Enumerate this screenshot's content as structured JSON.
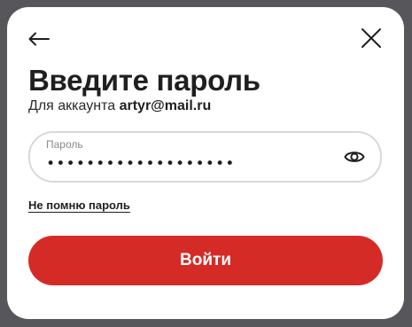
{
  "header": {
    "back_icon": "arrow-left-icon",
    "close_icon": "close-icon"
  },
  "title": "Введите пароль",
  "subtitle": {
    "prefix": "Для аккаунта",
    "email": "artyr@mail.ru"
  },
  "password_field": {
    "label": "Пароль",
    "value": "•••••••••••••••••••",
    "toggle_icon": "eye-icon"
  },
  "forgot_link": "Не помню пароль",
  "submit_button": "Войти",
  "colors": {
    "accent": "#d52b26",
    "backdrop": "#57575b",
    "text": "#1f1f1f",
    "field_border": "#d8d8d8"
  }
}
